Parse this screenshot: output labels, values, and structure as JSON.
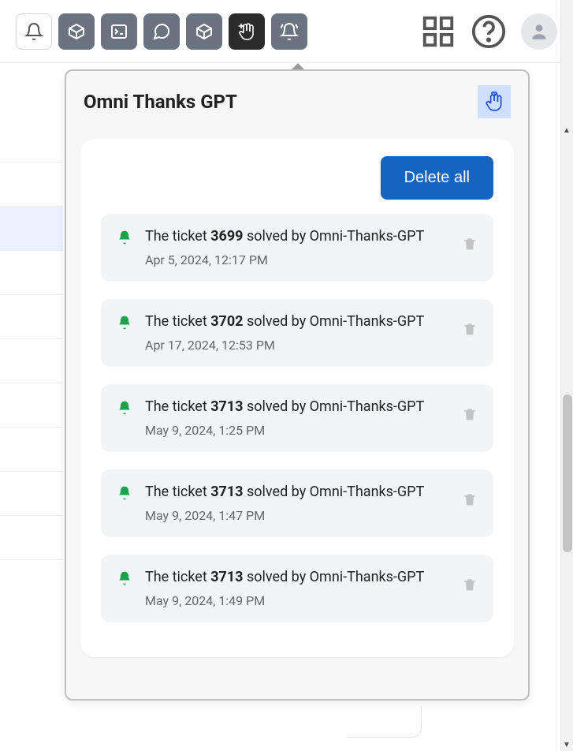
{
  "topbar": {
    "icons": {
      "notifications": "bell-icon",
      "box1": "cube-icon",
      "terminal": "terminal-icon",
      "chat": "chat-icon",
      "box2": "cube-icon",
      "thanks": "hand-sparkle-icon",
      "alert_bell": "ringing-bell-icon",
      "apps": "grid-icon",
      "help": "help-icon",
      "avatar": "user-avatar"
    }
  },
  "popover": {
    "title": "Omni Thanks GPT",
    "delete_all_label": "Delete all",
    "logo_name": "thanks-logo"
  },
  "notifications": [
    {
      "prefix": "The ticket ",
      "ticket": "3699",
      "suffix": " solved by Omni-Thanks-GPT",
      "date": "Apr 5, 2024, 12:17 PM"
    },
    {
      "prefix": "The ticket ",
      "ticket": "3702",
      "suffix": " solved by Omni-Thanks-GPT",
      "date": "Apr 17, 2024, 12:53 PM"
    },
    {
      "prefix": "The ticket ",
      "ticket": "3713",
      "suffix": " solved by Omni-Thanks-GPT",
      "date": "May 9, 2024, 1:25 PM"
    },
    {
      "prefix": "The ticket ",
      "ticket": "3713",
      "suffix": " solved by Omni-Thanks-GPT",
      "date": "May 9, 2024, 1:47 PM"
    },
    {
      "prefix": "The ticket ",
      "ticket": "3713",
      "suffix": " solved by Omni-Thanks-GPT",
      "date": "May 9, 2024, 1:49 PM"
    }
  ]
}
